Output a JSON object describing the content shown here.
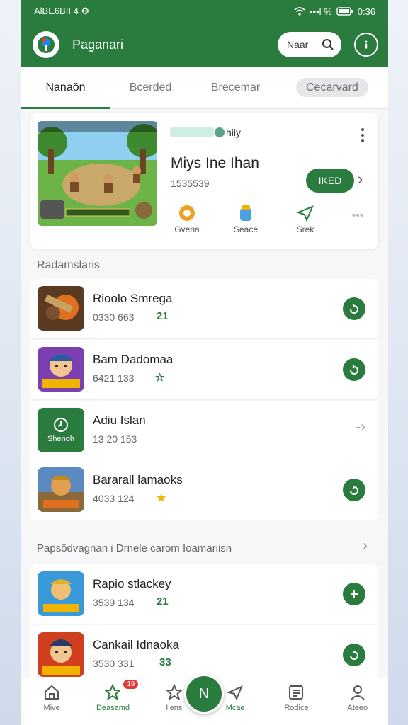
{
  "status_bar": {
    "left": "AlBE6BII 4 ⚙",
    "signal": "•••l %",
    "time": "0:36"
  },
  "app_bar": {
    "title": "Paganari",
    "search_label": "Naar"
  },
  "tabs": [
    {
      "label": "Nanaön",
      "active": true
    },
    {
      "label": "Bcerded",
      "active": false
    },
    {
      "label": "Brecemar",
      "active": false
    },
    {
      "label": "Cecarvard",
      "active": false
    }
  ],
  "featured": {
    "tag": "hiiy",
    "title": "Miys Ine Ihan",
    "subtitle": "1535539",
    "install_label": "IKED",
    "actions": [
      {
        "label": "Gvena",
        "icon": "shield-icon"
      },
      {
        "label": "Seace",
        "icon": "jar-icon"
      },
      {
        "label": "Srek",
        "icon": "send-icon"
      }
    ]
  },
  "section1": {
    "title": "Radamslaris"
  },
  "list1": [
    {
      "title": "Rioolo Smrega",
      "subtitle": "0330 663",
      "badge": "21",
      "action": "refresh-icon"
    },
    {
      "title": "Bam Dadomaa",
      "subtitle": "6421 133",
      "badge": "☆",
      "action": "refresh-icon"
    },
    {
      "title": "Adiu Islan",
      "subtitle": "13 20 153",
      "badge": "",
      "action": "arrow-icon",
      "thumb_label": "Shenoh"
    },
    {
      "title": "Bararall lamaoks",
      "subtitle": "4033 124",
      "badge": "★",
      "action": "refresh-icon"
    }
  ],
  "section2": {
    "title": "Papsödvagnan i  Drnele carom  Ioamariisn"
  },
  "list2": [
    {
      "title": "Rapio stlackey",
      "subtitle": "3539 134",
      "badge": "21",
      "action": "plus-icon"
    },
    {
      "title": "Cankail Idnaoka",
      "subtitle": "3530 331",
      "badge": "33",
      "action": "refresh-icon"
    }
  ],
  "bottom_nav": [
    {
      "label": "Mive",
      "icon": "home-icon",
      "active": false
    },
    {
      "label": "Deasamd",
      "icon": "star-icon",
      "active": true,
      "badge": "19"
    },
    {
      "label": "Ilens",
      "icon": "star-outline-icon",
      "active": false
    },
    {
      "label": "Mcae",
      "icon": "send-icon",
      "active": false
    },
    {
      "label": "Rodice",
      "icon": "list-icon",
      "active": false
    },
    {
      "label": "Ateeo",
      "icon": "person-icon",
      "active": false
    }
  ],
  "fab_label": "N",
  "colors": {
    "primary": "#2a7b3e",
    "accent_star": "#f0b400"
  }
}
